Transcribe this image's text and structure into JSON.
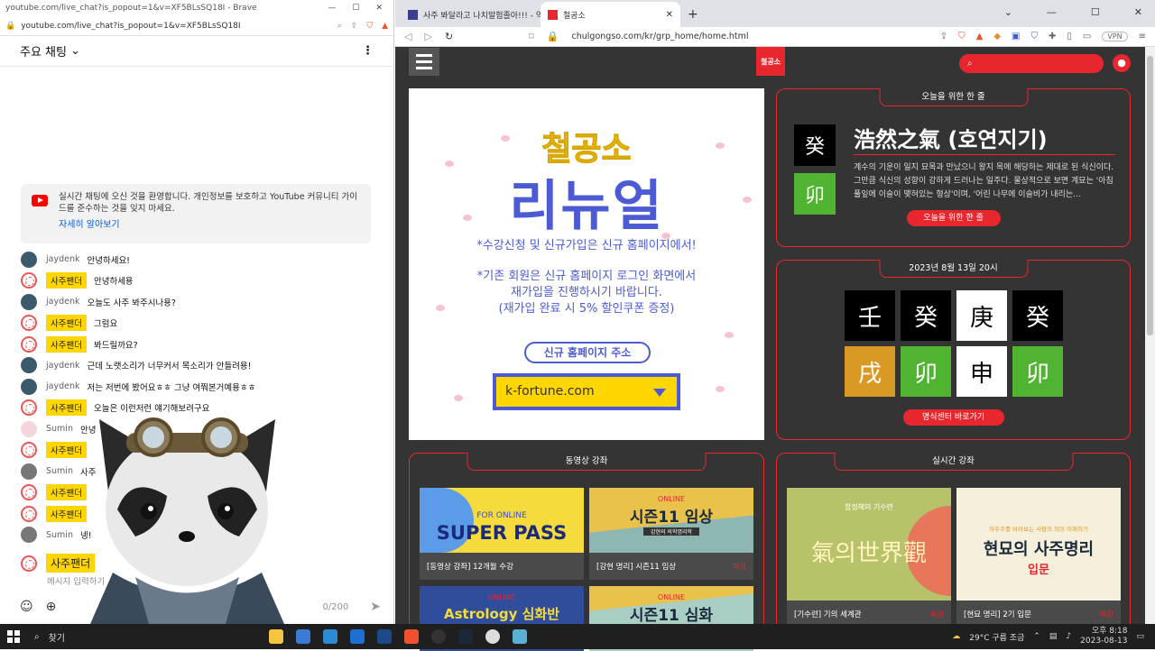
{
  "left_window": {
    "title": "youtube.com/live_chat?is_popout=1&v=XF5BLsSQ18I - Brave",
    "url": "youtube.com/live_chat?is_popout=1&v=XF5BLsSQ18I",
    "chat_header": "주요 채팅",
    "welcome_text": "실시간 채팅에 오신 것을 환영합니다. 개인정보를 보호하고 YouTube 커뮤니티 가이드를 준수하는 것을 잊지 마세요.",
    "welcome_link": "자세히 알아보기",
    "messages": [
      {
        "author": "jaydenk",
        "badge": false,
        "text": "안녕하세요!",
        "avatar": "dark"
      },
      {
        "author": "사주팬더",
        "badge": true,
        "text": "안녕하세용",
        "avatar": "red"
      },
      {
        "author": "jaydenk",
        "badge": false,
        "text": "오늘도 사주 봐주시나용?",
        "avatar": "dark"
      },
      {
        "author": "사주팬더",
        "badge": true,
        "text": "그럼요",
        "avatar": "red"
      },
      {
        "author": "사주팬더",
        "badge": true,
        "text": "봐드릴까요?",
        "avatar": "red"
      },
      {
        "author": "jaydenk",
        "badge": false,
        "text": "근데 노랫소리가 너무커서 목소리가 안들려용!",
        "avatar": "dark"
      },
      {
        "author": "jaydenk",
        "badge": false,
        "text": "저는 저번에 봤어요ㅎㅎ 그냥 여쭤본거예용ㅎㅎ",
        "avatar": "dark"
      },
      {
        "author": "사주팬더",
        "badge": true,
        "text": "오늘은 이런저런 얘기해보려구요",
        "avatar": "red"
      },
      {
        "author": "Sumin",
        "badge": false,
        "text": "안녕",
        "avatar": "pink"
      },
      {
        "author": "사주팬더",
        "badge": true,
        "text": "",
        "avatar": "red"
      },
      {
        "author": "Sumin",
        "badge": false,
        "text": "사주",
        "avatar": "bear"
      },
      {
        "author": "사주팬더",
        "badge": true,
        "text": "",
        "avatar": "red"
      },
      {
        "author": "사주팬더",
        "badge": true,
        "text": "",
        "avatar": "red"
      },
      {
        "author": "Sumin",
        "badge": false,
        "text": "넹!",
        "avatar": "bear"
      }
    ],
    "input_author": "사주팬더",
    "input_placeholder": "메시지 입력하기",
    "char_count": "0/200"
  },
  "right_window": {
    "tabs": [
      {
        "label": "사주 봐달라고 나치말험졸아!!! - 역대",
        "active": false
      },
      {
        "label": "철공소",
        "active": true
      }
    ],
    "url": "chulgongso.com/kr/grp_home/home.html",
    "vpn_label": "VPN",
    "logo_text": "철공소",
    "banner": {
      "title_small": "철공소",
      "title_big": "리뉴얼",
      "line1": "*수강신청 및 신규가입은 신규 홈페이지에서!",
      "line2": "*기존 회원은 신규 홈페이지 로그인 화면에서",
      "line3": "재가입을 진행하시기 바랍니다.",
      "line4": "(재가입 완료 시 5% 할인쿠폰 증정)",
      "address_label": "신규 홈페이지 주소",
      "address_value": "k-fortune.com"
    },
    "today": {
      "title": "오늘을 위한 한 줄",
      "stem": "癸",
      "branch": "卯",
      "idiom": "浩然之氣 (호연지기)",
      "text": "계수의 기운이 일지 묘목과 만났으니 왕지 목에 해당하는 제대로 된 식신이다. 그만큼 식신의 성향이 강하게 드러나는 일주다. 물상적으로 보면 계묘는 '아침 풀잎에 이슬이 맺혀있는 형상'이며, '어린 나무에 이슬비가 내리는...",
      "button": "오늘을 위한 한 줄"
    },
    "date_card": {
      "title": "2023년 8월 13일 20시",
      "stems": [
        "壬",
        "癸",
        "庚",
        "癸"
      ],
      "branches": [
        "戌",
        "卯",
        "申",
        "卯"
      ],
      "button": "명식센터 바로가기"
    },
    "video_card": {
      "title": "동영상 강좌",
      "items": [
        {
          "caption": "[동영상 강좌] 12개월 수강",
          "tag": "",
          "img_top": "FOR ONLINE",
          "img_main": "SUPER PASS"
        },
        {
          "caption": "[강현 명리] 시즌11 임상",
          "tag": "마감",
          "img_top": "ONLINE",
          "img_main": "시즌11 임상",
          "img_sub": "강현의 의학명리학"
        },
        {
          "caption": "",
          "tag": "",
          "img_top": "ONLINE",
          "img_main": "Astrology 심화반"
        },
        {
          "caption": "",
          "tag": "",
          "img_top": "ONLINE",
          "img_main": "시즌11 심화"
        }
      ]
    },
    "live_card": {
      "title": "실시간 강좌",
      "items": [
        {
          "caption": "[기수련] 기의 세계관",
          "tag": "마감",
          "img_top": "함정혜의 기수련",
          "img_main": "氣의世界觀"
        },
        {
          "caption": "[현묘 명리] 2기 입문",
          "tag": "마감",
          "img_top": "하우주를 바라보는 사람의 의미 이해하기",
          "img_main": "현묘의 사주명리",
          "img_sub": "입문"
        }
      ]
    }
  },
  "taskbar": {
    "search_label": "찾기",
    "weather": "29°C  구름 조금",
    "time": "오후 8:18",
    "date": "2023-08-13"
  }
}
